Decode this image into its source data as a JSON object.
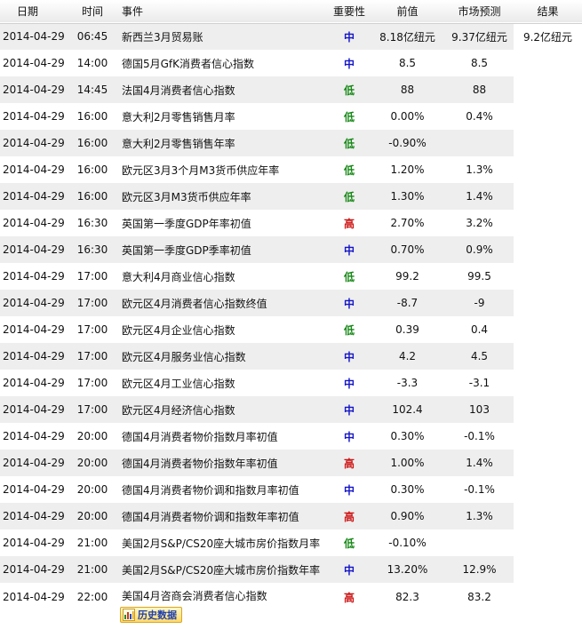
{
  "header": {
    "date": "日期",
    "time": "时间",
    "event": "事件",
    "importance": "重要性",
    "previous": "前值",
    "forecast": "市场预测",
    "result": "结果"
  },
  "rows": [
    {
      "date": "2014-04-29",
      "time": "06:45",
      "event": "新西兰3月贸易账",
      "importance": "中",
      "previous": "8.18亿纽元",
      "forecast": "9.37亿纽元",
      "result": "9.2亿纽元"
    },
    {
      "date": "2014-04-29",
      "time": "14:00",
      "event": "德国5月GfK消费者信心指数",
      "importance": "中",
      "previous": "8.5",
      "forecast": "8.5",
      "result": ""
    },
    {
      "date": "2014-04-29",
      "time": "14:45",
      "event": "法国4月消费者信心指数",
      "importance": "低",
      "previous": "88",
      "forecast": "88",
      "result": ""
    },
    {
      "date": "2014-04-29",
      "time": "16:00",
      "event": "意大利2月零售销售月率",
      "importance": "低",
      "previous": "0.00%",
      "forecast": "0.4%",
      "result": ""
    },
    {
      "date": "2014-04-29",
      "time": "16:00",
      "event": "意大利2月零售销售年率",
      "importance": "低",
      "previous": "-0.90%",
      "forecast": "",
      "result": ""
    },
    {
      "date": "2014-04-29",
      "time": "16:00",
      "event": "欧元区3月3个月M3货币供应年率",
      "importance": "低",
      "previous": "1.20%",
      "forecast": "1.3%",
      "result": ""
    },
    {
      "date": "2014-04-29",
      "time": "16:00",
      "event": "欧元区3月M3货币供应年率",
      "importance": "低",
      "previous": "1.30%",
      "forecast": "1.4%",
      "result": ""
    },
    {
      "date": "2014-04-29",
      "time": "16:30",
      "event": "英国第一季度GDP年率初值",
      "importance": "高",
      "previous": "2.70%",
      "forecast": "3.2%",
      "result": ""
    },
    {
      "date": "2014-04-29",
      "time": "16:30",
      "event": "英国第一季度GDP季率初值",
      "importance": "中",
      "previous": "0.70%",
      "forecast": "0.9%",
      "result": ""
    },
    {
      "date": "2014-04-29",
      "time": "17:00",
      "event": "意大利4月商业信心指数",
      "importance": "低",
      "previous": "99.2",
      "forecast": "99.5",
      "result": ""
    },
    {
      "date": "2014-04-29",
      "time": "17:00",
      "event": "欧元区4月消费者信心指数终值",
      "importance": "中",
      "previous": "-8.7",
      "forecast": "-9",
      "result": ""
    },
    {
      "date": "2014-04-29",
      "time": "17:00",
      "event": "欧元区4月企业信心指数",
      "importance": "低",
      "previous": "0.39",
      "forecast": "0.4",
      "result": ""
    },
    {
      "date": "2014-04-29",
      "time": "17:00",
      "event": "欧元区4月服务业信心指数",
      "importance": "中",
      "previous": "4.2",
      "forecast": "4.5",
      "result": ""
    },
    {
      "date": "2014-04-29",
      "time": "17:00",
      "event": "欧元区4月工业信心指数",
      "importance": "中",
      "previous": "-3.3",
      "forecast": "-3.1",
      "result": ""
    },
    {
      "date": "2014-04-29",
      "time": "17:00",
      "event": "欧元区4月经济信心指数",
      "importance": "中",
      "previous": "102.4",
      "forecast": "103",
      "result": ""
    },
    {
      "date": "2014-04-29",
      "time": "20:00",
      "event": "德国4月消费者物价指数月率初值",
      "importance": "中",
      "previous": "0.30%",
      "forecast": "-0.1%",
      "result": ""
    },
    {
      "date": "2014-04-29",
      "time": "20:00",
      "event": "德国4月消费者物价指数年率初值",
      "importance": "高",
      "previous": "1.00%",
      "forecast": "1.4%",
      "result": ""
    },
    {
      "date": "2014-04-29",
      "time": "20:00",
      "event": "德国4月消费者物价调和指数月率初值",
      "importance": "中",
      "previous": "0.30%",
      "forecast": "-0.1%",
      "result": ""
    },
    {
      "date": "2014-04-29",
      "time": "20:00",
      "event": "德国4月消费者物价调和指数年率初值",
      "importance": "高",
      "previous": "0.90%",
      "forecast": "1.3%",
      "result": ""
    },
    {
      "date": "2014-04-29",
      "time": "21:00",
      "event": "美国2月S&P/CS20座大城市房价指数月率",
      "importance": "低",
      "previous": "-0.10%",
      "forecast": "",
      "result": ""
    },
    {
      "date": "2014-04-29",
      "time": "21:00",
      "event": "美国2月S&P/CS20座大城市房价指数年率",
      "importance": "中",
      "previous": "13.20%",
      "forecast": "12.9%",
      "result": ""
    },
    {
      "date": "2014-04-29",
      "time": "22:00",
      "event": "美国4月咨商会消费者信心指数",
      "importance": "高",
      "previous": "82.3",
      "forecast": "83.2",
      "result": ""
    }
  ],
  "history_button": {
    "label": "历史数据",
    "icon": "bar-chart-icon"
  },
  "colors": {
    "importance_medium": "#1515c8",
    "importance_low": "#158815",
    "importance_high": "#cc1111",
    "header_bg": "#eaeaea",
    "row_alt_bg": "#eeeeee"
  }
}
